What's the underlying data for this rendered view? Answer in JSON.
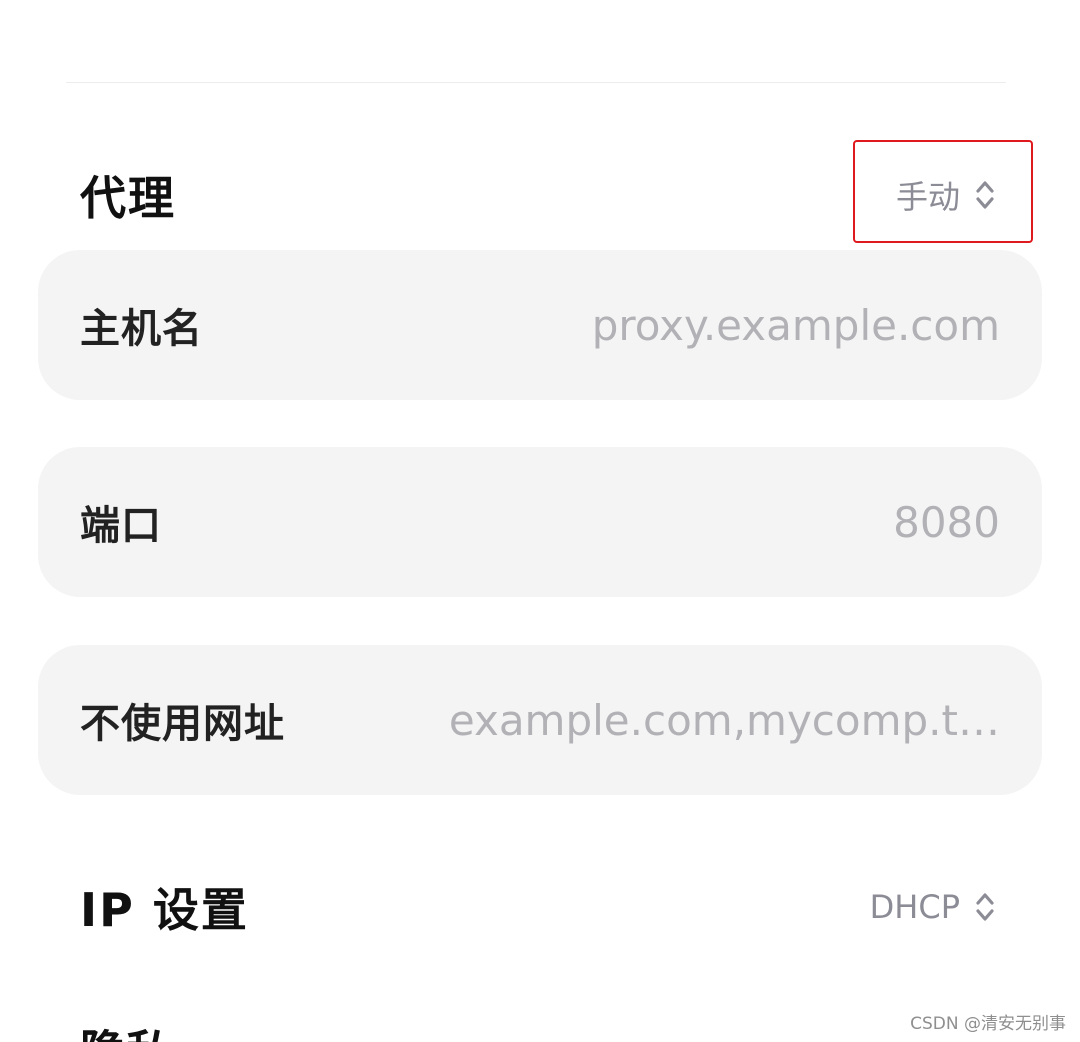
{
  "proxy": {
    "title": "代理",
    "mode_value": "手动",
    "highlight_color": "#e0191f"
  },
  "fields": {
    "hostname": {
      "label": "主机名",
      "placeholder": "proxy.example.com"
    },
    "port": {
      "label": "端口",
      "placeholder": "8080"
    },
    "bypass": {
      "label": "不使用网址",
      "placeholder": "example.com,mycomp.t…"
    }
  },
  "ip_settings": {
    "title": "IP 设置",
    "mode_value": "DHCP"
  },
  "next_section": {
    "title": "隐私"
  },
  "watermark": "CSDN @清安无别事",
  "icons": {
    "selector": "chevron-up-down-icon"
  }
}
